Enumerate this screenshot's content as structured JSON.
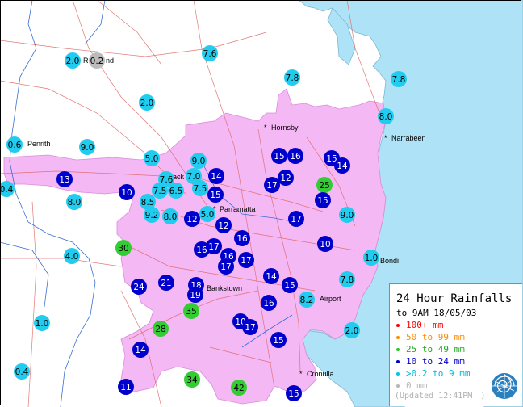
{
  "map": {
    "places": [
      {
        "label": "Penrith"
      },
      {
        "label": "Hornsby"
      },
      {
        "label": "Narrabeen"
      },
      {
        "label": "Parramatta"
      },
      {
        "label": "Bondi"
      },
      {
        "label": "Bankstown"
      },
      {
        "label": "Airport"
      },
      {
        "label": "Cronulla"
      },
      {
        "label": "ack"
      },
      {
        "label": "R"
      },
      {
        "label": "nd"
      }
    ],
    "stations": [
      {
        "v": "2.0",
        "c": "lb"
      },
      {
        "v": "0.2",
        "c": "gray"
      },
      {
        "v": "7.6",
        "c": "lb"
      },
      {
        "v": "7.8",
        "c": "lb"
      },
      {
        "v": "7.8",
        "c": "lb"
      },
      {
        "v": "2.0",
        "c": "lb"
      },
      {
        "v": "8.0",
        "c": "lb"
      },
      {
        "v": "0.6",
        "c": "lb"
      },
      {
        "v": "9.0",
        "c": "lb"
      },
      {
        "v": "5.0",
        "c": "lb"
      },
      {
        "v": "9.0",
        "c": "lb"
      },
      {
        "v": "15",
        "c": "db"
      },
      {
        "v": "16",
        "c": "db"
      },
      {
        "v": "15",
        "c": "db"
      },
      {
        "v": "14",
        "c": "db"
      },
      {
        "v": "13",
        "c": "db"
      },
      {
        "v": "7.6",
        "c": "lb"
      },
      {
        "v": "7.0",
        "c": "lb"
      },
      {
        "v": "14",
        "c": "db"
      },
      {
        "v": "17",
        "c": "db"
      },
      {
        "v": "12",
        "c": "db"
      },
      {
        "v": "25",
        "c": "gr"
      },
      {
        "v": "0.4",
        "c": "lb"
      },
      {
        "v": "10",
        "c": "db"
      },
      {
        "v": "7.5",
        "c": "lb"
      },
      {
        "v": "6.5",
        "c": "lb"
      },
      {
        "v": "7.5",
        "c": "lb"
      },
      {
        "v": "15",
        "c": "db"
      },
      {
        "v": "15",
        "c": "db"
      },
      {
        "v": "8.0",
        "c": "lb"
      },
      {
        "v": "8.5",
        "c": "lb"
      },
      {
        "v": "9.2",
        "c": "lb"
      },
      {
        "v": "8.0",
        "c": "lb"
      },
      {
        "v": "12",
        "c": "db"
      },
      {
        "v": "5.0",
        "c": "lb"
      },
      {
        "v": "17",
        "c": "db"
      },
      {
        "v": "9.0",
        "c": "lb"
      },
      {
        "v": "12",
        "c": "db"
      },
      {
        "v": "16",
        "c": "db"
      },
      {
        "v": "30",
        "c": "gr"
      },
      {
        "v": "16",
        "c": "db"
      },
      {
        "v": "17",
        "c": "db"
      },
      {
        "v": "16",
        "c": "db"
      },
      {
        "v": "17",
        "c": "db"
      },
      {
        "v": "17",
        "c": "db"
      },
      {
        "v": "10",
        "c": "db"
      },
      {
        "v": "4.0",
        "c": "lb"
      },
      {
        "v": "1.0",
        "c": "lb"
      },
      {
        "v": "24",
        "c": "db"
      },
      {
        "v": "21",
        "c": "db"
      },
      {
        "v": "18",
        "c": "db"
      },
      {
        "v": "19",
        "c": "db"
      },
      {
        "v": "14",
        "c": "db"
      },
      {
        "v": "15",
        "c": "db"
      },
      {
        "v": "7.8",
        "c": "lb"
      },
      {
        "v": "35",
        "c": "gr"
      },
      {
        "v": "16",
        "c": "db"
      },
      {
        "v": "8.2",
        "c": "lb"
      },
      {
        "v": "1.0",
        "c": "lb"
      },
      {
        "v": "10",
        "c": "db"
      },
      {
        "v": "17",
        "c": "db"
      },
      {
        "v": "28",
        "c": "gr"
      },
      {
        "v": "2.0",
        "c": "lb"
      },
      {
        "v": "15",
        "c": "db"
      },
      {
        "v": "14",
        "c": "db"
      },
      {
        "v": "0.4",
        "c": "lb"
      },
      {
        "v": "34",
        "c": "gr"
      },
      {
        "v": "42",
        "c": "gr"
      },
      {
        "v": "11",
        "c": "db"
      },
      {
        "v": "15",
        "c": "db"
      }
    ]
  },
  "legend": {
    "title": "24 Hour Rainfalls",
    "subtitle": "to 9AM 18/05/03",
    "rows": [
      {
        "label": "100+ mm",
        "color": "#ff0000"
      },
      {
        "label": "50 to 99 mm",
        "color": "#ff8c00"
      },
      {
        "label": "25 to 49 mm",
        "color": "#22cc22"
      },
      {
        "label": "10 to 24 mm",
        "color": "#0000cc"
      },
      {
        "label": ">0.2 to 9 mm",
        "color": "#00c8e8"
      },
      {
        "label": "0 mm",
        "color": "#b8b8b8"
      }
    ],
    "updated": "(Updated 12:41PM",
    "updated_suffix": ")"
  },
  "colors": {
    "sea": "#aee2f6",
    "urban": "#f4b8f4",
    "light_blue_station": "#22ccee",
    "dark_blue_station": "#0000cc",
    "green_station": "#33cc33",
    "gray_station": "#bbbbbb"
  }
}
